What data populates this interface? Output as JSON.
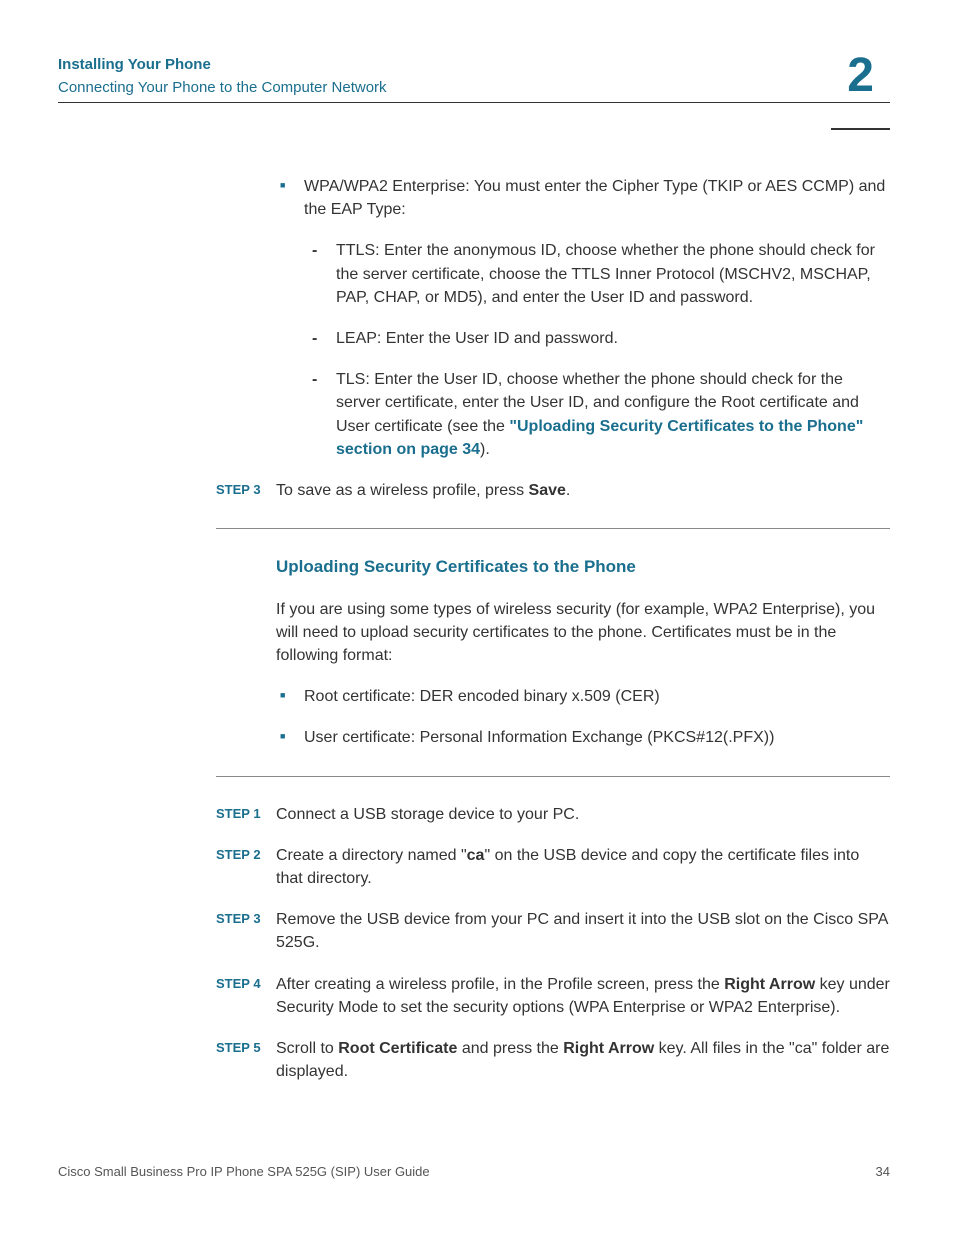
{
  "header": {
    "title": "Installing Your Phone",
    "subtitle": "Connecting Your Phone to the Computer Network",
    "chapter": "2"
  },
  "top": {
    "wpa_intro": "WPA/WPA2 Enterprise: You must enter the Cipher Type (TKIP or AES CCMP) and the EAP Type:",
    "ttls": "TTLS: Enter the anonymous ID, choose whether the phone should check for the server certificate, choose the TTLS Inner Protocol (MSCHV2, MSCHAP, PAP, CHAP, or MD5), and enter the User ID and password.",
    "leap": "LEAP: Enter the User ID and password.",
    "tls_a": "TLS: Enter the User ID, choose whether the phone should check for the server certificate, enter the User ID, and configure the Root certificate and User certificate (see the ",
    "tls_link": "\"Uploading Security Certificates to the Phone\" section on page 34",
    "tls_b": ").",
    "step3_label": "STEP 3",
    "step3_a": "To save as a wireless profile, press ",
    "step3_bold": "Save",
    "step3_b": "."
  },
  "upload": {
    "heading": "Uploading Security Certificates to the Phone",
    "intro": "If you are using some types of wireless security (for example, WPA2 Enterprise), you will need to upload security certificates to the phone. Certificates must be in the following format:",
    "root_cert": "Root certificate: DER encoded binary x.509 (CER)",
    "user_cert": "User certificate: Personal Information Exchange (PKCS#12(.PFX))",
    "steps": {
      "s1": {
        "label": "STEP 1",
        "text": "Connect a USB storage device to your PC."
      },
      "s2": {
        "label": "STEP 2",
        "a": "Create a directory named \"",
        "bold": "ca",
        "b": "\" on the USB device and copy the certificate files into that directory."
      },
      "s3": {
        "label": "STEP 3",
        "text": "Remove the USB device from your PC and insert it into the USB slot on the Cisco SPA 525G."
      },
      "s4": {
        "label": "STEP 4",
        "a": "After creating a wireless profile, in the Profile screen, press the ",
        "bold": "Right Arrow",
        "b": " key under Security Mode to set the security options (WPA Enterprise or WPA2 Enterprise)."
      },
      "s5": {
        "label": "STEP 5",
        "a": "Scroll to ",
        "bold1": "Root Certificate",
        "b": " and press the ",
        "bold2": "Right Arrow",
        "c": " key. All files in the \"ca\" folder are displayed."
      }
    }
  },
  "footer": {
    "guide": "Cisco Small Business Pro IP Phone SPA 525G (SIP) User Guide",
    "page": "34"
  }
}
